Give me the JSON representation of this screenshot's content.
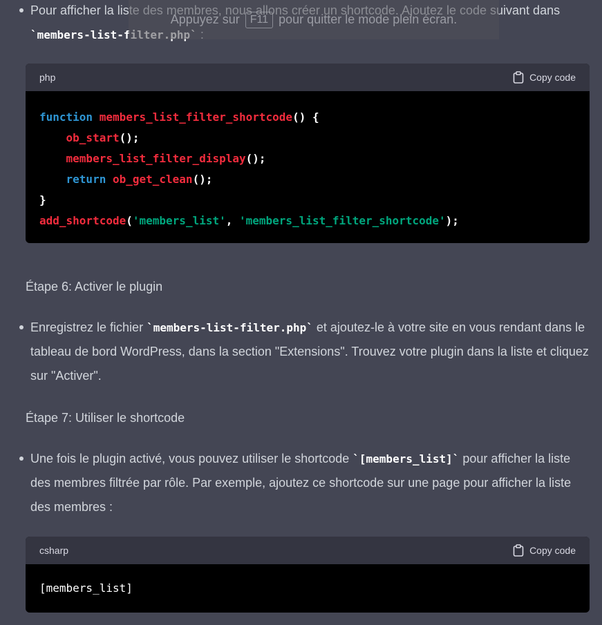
{
  "bullets": [
    {
      "text_before": "Pour afficher la liste des membres, nous allons créer un shortcode. Ajoutez le code suivant dans ",
      "code": "`members-list-filter.php`",
      "text_after": " :"
    },
    {
      "text_before": "Enregistrez le fichier ",
      "code": "`members-list-filter.php`",
      "text_after": " et ajoutez-le à votre site en vous rendant dans le tableau de bord WordPress, dans la section \"Extensions\". Trouvez votre plugin dans la liste et cliquez sur \"Activer\"."
    },
    {
      "text_before": "Une fois le plugin activé, vous pouvez utiliser le shortcode ",
      "code": "`[members_list]`",
      "text_after": " pour afficher la liste des membres filtrée par rôle. Par exemple, ajoutez ce shortcode sur une page pour afficher la liste des membres :"
    }
  ],
  "steps": [
    "Étape 6: Activer le plugin",
    "Étape 7: Utiliser le shortcode"
  ],
  "code_blocks": [
    {
      "language": "php",
      "copy_label": "Copy code",
      "lines": [
        [
          {
            "t": "kw",
            "v": "function"
          },
          {
            "t": "plain",
            "v": " "
          },
          {
            "t": "fn",
            "v": "members_list_filter_shortcode"
          },
          {
            "t": "plain",
            "v": "() {"
          }
        ],
        [
          {
            "t": "plain",
            "v": "    "
          },
          {
            "t": "fn",
            "v": "ob_start"
          },
          {
            "t": "plain",
            "v": "();"
          }
        ],
        [
          {
            "t": "plain",
            "v": "    "
          },
          {
            "t": "fn",
            "v": "members_list_filter_display"
          },
          {
            "t": "plain",
            "v": "();"
          }
        ],
        [
          {
            "t": "plain",
            "v": "    "
          },
          {
            "t": "kw",
            "v": "return"
          },
          {
            "t": "plain",
            "v": " "
          },
          {
            "t": "fn",
            "v": "ob_get_clean"
          },
          {
            "t": "plain",
            "v": "();"
          }
        ],
        [
          {
            "t": "plain",
            "v": "}"
          }
        ],
        [
          {
            "t": "fn",
            "v": "add_shortcode"
          },
          {
            "t": "plain",
            "v": "("
          },
          {
            "t": "str",
            "v": "'members_list'"
          },
          {
            "t": "plain",
            "v": ", "
          },
          {
            "t": "str",
            "v": "'members_list_filter_shortcode'"
          },
          {
            "t": "plain",
            "v": ");"
          }
        ]
      ]
    },
    {
      "language": "csharp",
      "copy_label": "Copy code",
      "lines": [
        [
          {
            "t": "plain",
            "v": "[members_list]"
          }
        ]
      ]
    }
  ],
  "fullscreen_hint": {
    "before": "Appuyez sur",
    "key": "F11",
    "after": "pour quitter le mode plein écran."
  },
  "colors": {
    "background": "#444654",
    "code_bg": "#000000",
    "code_header_bg": "#343541",
    "keyword": "#2e95d3",
    "function": "#f22c3d",
    "string": "#00a67d"
  }
}
